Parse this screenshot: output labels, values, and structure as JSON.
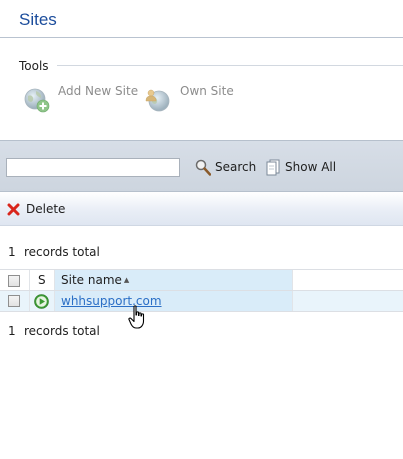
{
  "page": {
    "title": "Sites"
  },
  "tools": {
    "title": "Tools",
    "items": [
      {
        "label": "Add New Site",
        "icon": "add-globe-icon"
      },
      {
        "label": "Own Site",
        "icon": "user-globe-icon"
      }
    ]
  },
  "search": {
    "value": "",
    "search_label": "Search",
    "show_all_label": "Show All"
  },
  "actions": {
    "delete_label": "Delete"
  },
  "records": {
    "count": "1",
    "suffix": "records total"
  },
  "grid": {
    "columns": {
      "status": "S",
      "site_name": "Site name"
    },
    "sort": {
      "column": "site_name",
      "direction": "ascending"
    },
    "rows": [
      {
        "status": "running",
        "site_name": "whhsupport.com"
      }
    ]
  },
  "colors": {
    "title": "#1c4d9c",
    "link": "#2b6fc6",
    "status_running": "#3c9a35",
    "delete": "#d9261c"
  }
}
